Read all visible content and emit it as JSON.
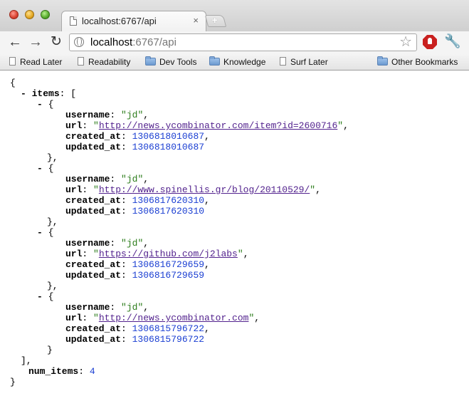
{
  "window": {
    "tab_title": "localhost:6767/api",
    "tab_close_glyph": "×",
    "new_tab_glyph": "+"
  },
  "toolbar": {
    "back_icon": "←",
    "forward_icon": "→",
    "reload_icon": "↻",
    "url_host": "localhost",
    "url_rest": ":6767/api",
    "star_icon": "☆",
    "wrench_icon": "🔧"
  },
  "bookmarks": {
    "items": [
      {
        "label": "Read Later",
        "icon": "page-icon"
      },
      {
        "label": "Readability",
        "icon": "page-icon"
      },
      {
        "label": "Dev Tools",
        "icon": "folder-icon"
      },
      {
        "label": "Knowledge",
        "icon": "folder-icon"
      },
      {
        "label": "Surf Later",
        "icon": "page-icon"
      }
    ],
    "other_label": "Other Bookmarks"
  },
  "json_view": {
    "open_brace": "{",
    "close_brace": "}",
    "items_key": "items",
    "num_items_key": "num_items",
    "num_items_value": "4",
    "collapse_glyph": "-",
    "item_open": "{",
    "item_close": "},",
    "last_item_close": "}",
    "array_open": "[",
    "array_close": "],",
    "keys": {
      "username": "username",
      "url": "url",
      "created_at": "created_at",
      "updated_at": "updated_at"
    },
    "items": [
      {
        "username": "jd",
        "url": "http://news.ycombinator.com/item?id=2600716",
        "created_at": "1306818010687",
        "updated_at": "1306818010687"
      },
      {
        "username": "jd",
        "url": "http://www.spinellis.gr/blog/20110529/",
        "created_at": "1306817620310",
        "updated_at": "1306817620310"
      },
      {
        "username": "jd",
        "url": "https://github.com/j2labs",
        "created_at": "1306816729659",
        "updated_at": "1306816729659"
      },
      {
        "username": "jd",
        "url": "http://news.ycombinator.com",
        "created_at": "1306815796722",
        "updated_at": "1306815796722"
      }
    ]
  }
}
